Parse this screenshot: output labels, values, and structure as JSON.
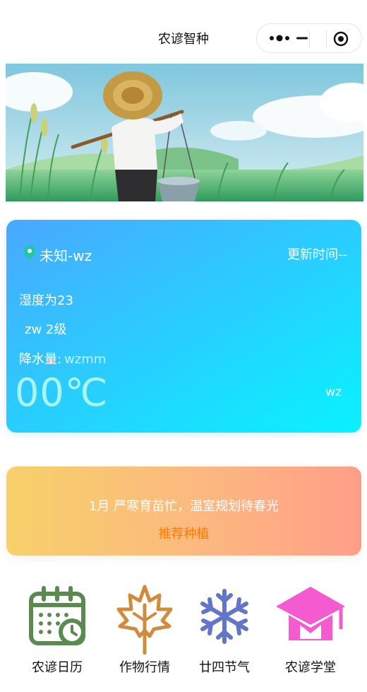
{
  "app": {
    "title": "农谚智种"
  },
  "weather": {
    "location": "未知-wz",
    "update_time": "更新时间--",
    "humidity": "湿度为23",
    "wind": "zw 2级",
    "precip_label": "降水量:",
    "precip_value": "wzmm",
    "temperature": "00℃",
    "description": "wz"
  },
  "recommendation": {
    "text": "1月 严寒育苗忙，温室规划待春光",
    "button": "推荐种植"
  },
  "features": [
    {
      "label": "农谚日历",
      "icon": "calendar-icon",
      "color": "#5b8a50"
    },
    {
      "label": "作物行情",
      "icon": "leaf-icon",
      "color": "#d08c3c"
    },
    {
      "label": "廿四节气",
      "icon": "snowflake-icon",
      "color": "#6276c8"
    },
    {
      "label": "农谚学堂",
      "icon": "graduation-cap-icon",
      "color": "#f55bd0"
    }
  ],
  "colors": {
    "weather_gradient_start": "#4aa8ff",
    "weather_gradient_end": "#08f2ff",
    "reco_gradient_start": "#f7d16a",
    "reco_gradient_end": "#ff9e88",
    "reco_button": "#ff7a00",
    "temperature": "#a9f5e9"
  }
}
